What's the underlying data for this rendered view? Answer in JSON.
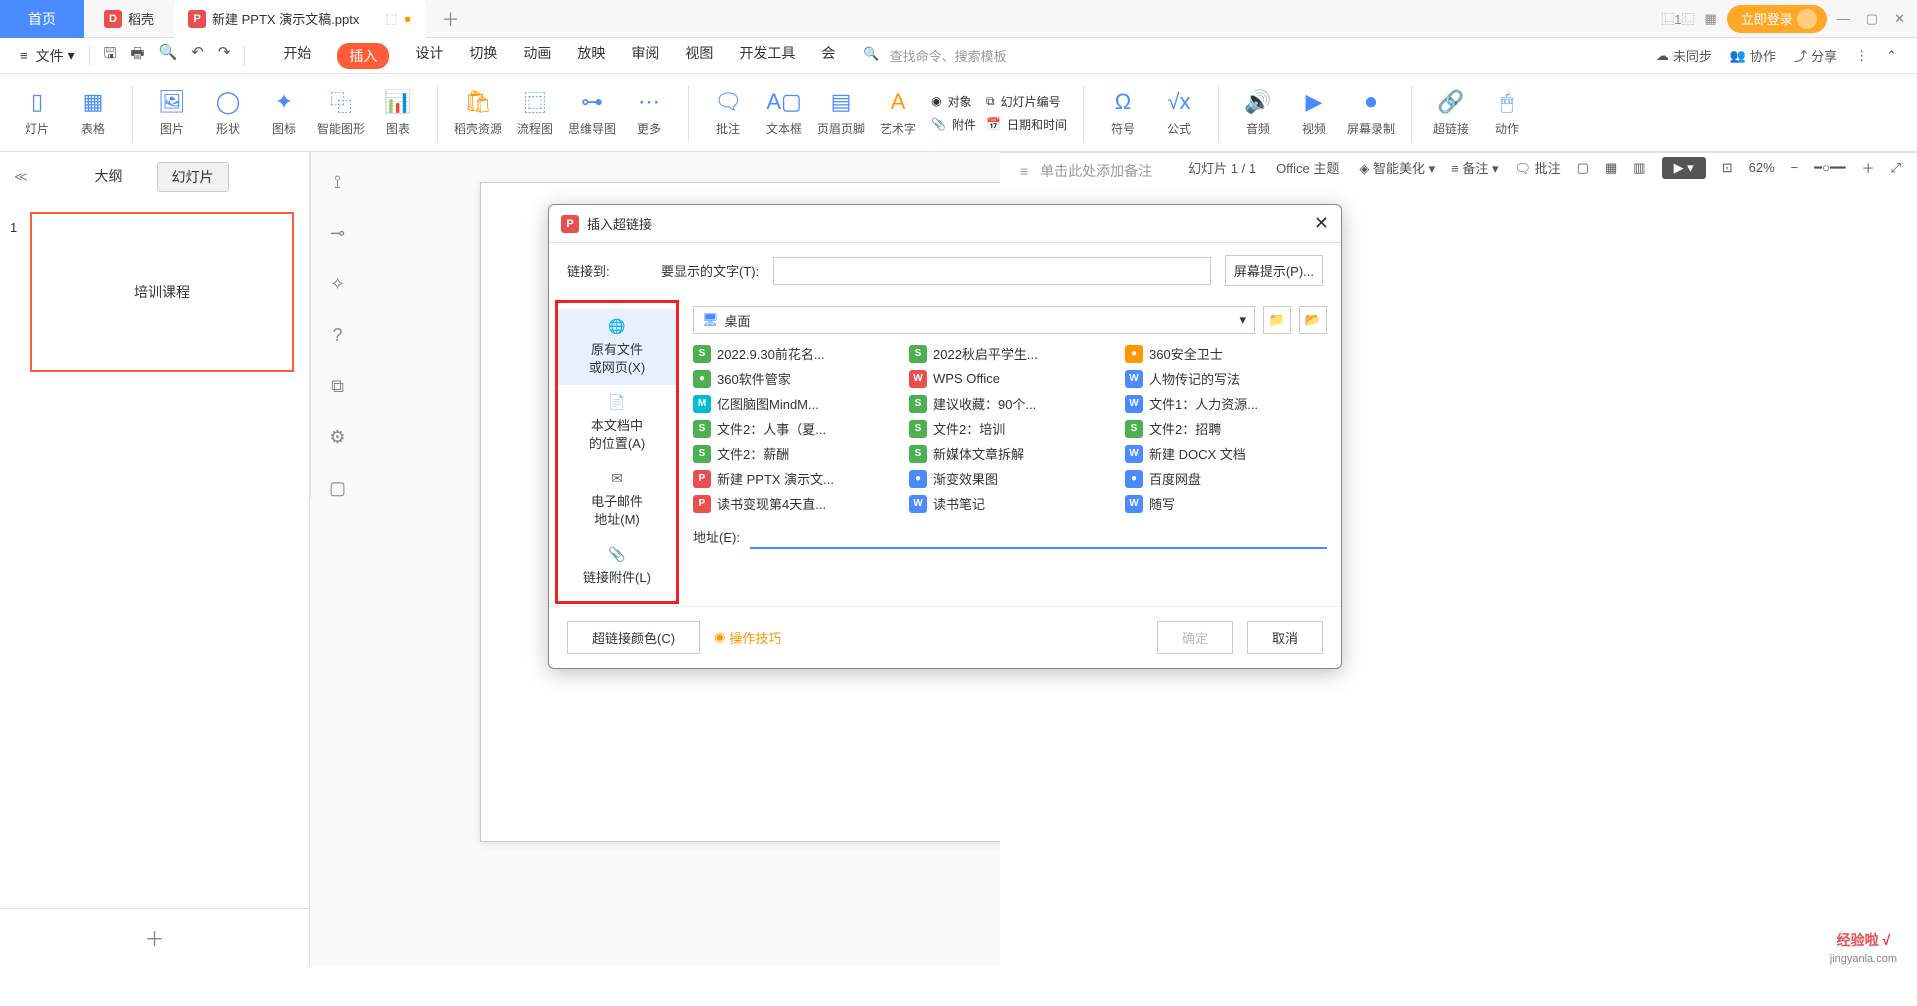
{
  "titleBar": {
    "homeTab": "首页",
    "dockerTab": "稻壳",
    "activeTab": "新建 PPTX 演示文稿.pptx",
    "login": "立即登录"
  },
  "menuBar": {
    "file": "文件",
    "tabs": [
      "开始",
      "插入",
      "设计",
      "切换",
      "动画",
      "放映",
      "审阅",
      "视图",
      "开发工具",
      "会"
    ],
    "activeTab": "插入",
    "searchCmd": "查找命令、搜索模板",
    "unsync": "未同步",
    "collab": "协作",
    "share": "分享"
  },
  "ribbon": {
    "slide": "灯片",
    "table": "表格",
    "image": "图片",
    "shape": "形状",
    "icon": "图标",
    "smartart": "智能图形",
    "chart": "图表",
    "resource": "稻壳资源",
    "flowchart": "流程图",
    "mindmap": "思维导图",
    "more": "更多",
    "comment": "批注",
    "textbox": "文本框",
    "headerfooter": "页眉页脚",
    "wordart": "艺术字",
    "object": "对象",
    "slideNum": "幻灯片编号",
    "attachment": "附件",
    "datetime": "日期和时间",
    "symbol": "符号",
    "formula": "公式",
    "audio": "音频",
    "video": "视频",
    "screenrec": "屏幕录制",
    "hyperlink": "超链接",
    "action": "动作"
  },
  "leftPanel": {
    "outline": "大纲",
    "slides": "幻灯片",
    "thumbText": "培训课程",
    "thumbNum": "1"
  },
  "dialog": {
    "title": "插入超链接",
    "linkTo": "链接到:",
    "displayText": "要显示的文字(T):",
    "screenTip": "屏幕提示(P)...",
    "linkTypes": {
      "existing": "原有文件\n或网页(X)",
      "thisDoc": "本文档中\n的位置(A)",
      "email": "电子邮件\n地址(M)",
      "attach": "链接附件(L)"
    },
    "location": "桌面",
    "files": [
      {
        "name": "2022.9.30前花名...",
        "icon": "fi-green",
        "glyph": "S"
      },
      {
        "name": "2022秋启平学生...",
        "icon": "fi-green",
        "glyph": "S"
      },
      {
        "name": "360安全卫士",
        "icon": "fi-orange",
        "glyph": "●"
      },
      {
        "name": "360软件管家",
        "icon": "fi-green",
        "glyph": "●"
      },
      {
        "name": "WPS Office",
        "icon": "fi-red",
        "glyph": "W"
      },
      {
        "name": "人物传记的写法",
        "icon": "fi-blue",
        "glyph": "W"
      },
      {
        "name": "亿图脑图MindM...",
        "icon": "fi-teal",
        "glyph": "M"
      },
      {
        "name": "建议收藏：90个...",
        "icon": "fi-green",
        "glyph": "S"
      },
      {
        "name": "文件1：人力资源...",
        "icon": "fi-blue",
        "glyph": "W"
      },
      {
        "name": "文件2：人事（夏...",
        "icon": "fi-green",
        "glyph": "S"
      },
      {
        "name": "文件2：培训",
        "icon": "fi-green",
        "glyph": "S"
      },
      {
        "name": "文件2：招聘",
        "icon": "fi-green",
        "glyph": "S"
      },
      {
        "name": "文件2：薪酬",
        "icon": "fi-green",
        "glyph": "S"
      },
      {
        "name": "新媒体文章拆解",
        "icon": "fi-green",
        "glyph": "S"
      },
      {
        "name": "新建 DOCX 文档",
        "icon": "fi-blue",
        "glyph": "W"
      },
      {
        "name": "新建 PPTX 演示文...",
        "icon": "fi-red",
        "glyph": "P"
      },
      {
        "name": "渐变效果图",
        "icon": "fi-blue",
        "glyph": "●"
      },
      {
        "name": "百度网盘",
        "icon": "fi-blue",
        "glyph": "●"
      },
      {
        "name": "读书变现第4天直...",
        "icon": "fi-red",
        "glyph": "P"
      },
      {
        "name": "读书笔记",
        "icon": "fi-blue",
        "glyph": "W"
      },
      {
        "name": "随写",
        "icon": "fi-blue",
        "glyph": "W"
      }
    ],
    "address": "地址(E):",
    "linkColor": "超链接颜色(C)",
    "tips": "操作技巧",
    "ok": "确定",
    "cancel": "取消"
  },
  "notes": "单击此处添加备注",
  "statusBar": {
    "slideInfo": "幻灯片 1 / 1",
    "theme": "Office 主题",
    "beautify": "智能美化",
    "remark": "备注",
    "comments": "批注",
    "zoom": "62%"
  },
  "watermark": {
    "main": "经验啦",
    "check": "√",
    "sub": "jingyanla.com"
  }
}
